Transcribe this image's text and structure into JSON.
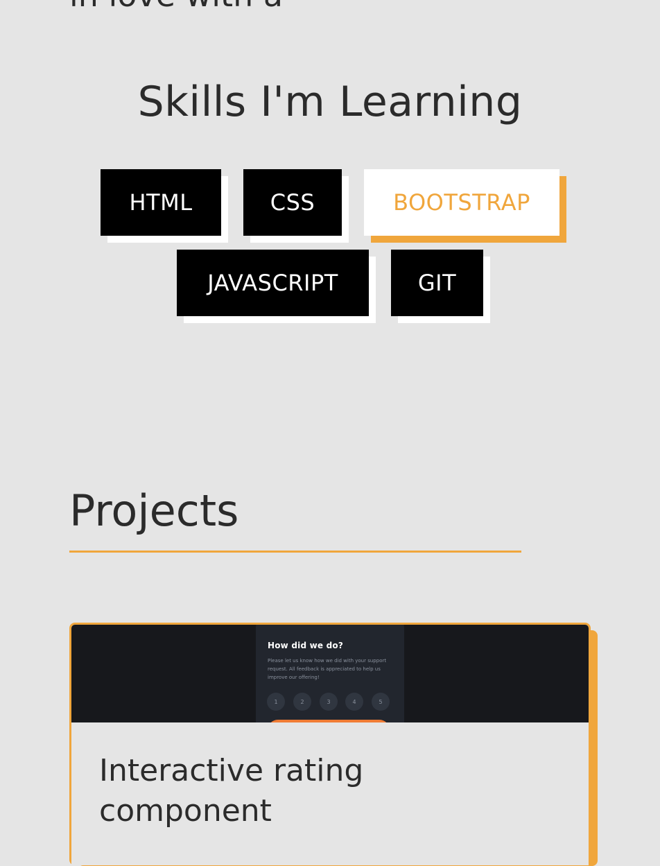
{
  "about": {
    "cut_heading": "in love with a"
  },
  "skills": {
    "title": "Skills I'm Learning",
    "items": [
      {
        "label": "HTML",
        "active": false
      },
      {
        "label": "CSS",
        "active": false
      },
      {
        "label": "BOOTSTRAP",
        "active": true
      },
      {
        "label": "JAVASCRIPT",
        "active": false
      },
      {
        "label": "GIT",
        "active": false
      }
    ]
  },
  "projects": {
    "title": "Projects",
    "cards": [
      {
        "title": "Interactive rating component",
        "preview": {
          "heading": "How did we do?",
          "description": "Please let us know how we did with your support request. All feedback is appreciated to help us improve our offering!",
          "ratings": [
            "1",
            "2",
            "3",
            "4",
            "5"
          ]
        }
      }
    ]
  },
  "colors": {
    "accent": "#f0a63c",
    "background": "#e5e5e5",
    "chip_bg": "#000000",
    "chip_text": "#ffffff",
    "text": "#2b2b2b"
  }
}
